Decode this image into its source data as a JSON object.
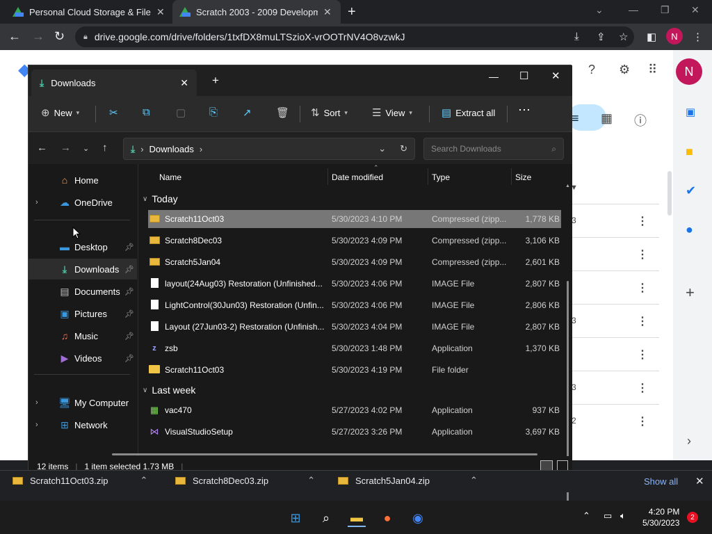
{
  "browser": {
    "tabs": [
      {
        "title": "Personal Cloud Storage & File Sh",
        "active": false
      },
      {
        "title": "Scratch 2003 - 2009 Developmen",
        "active": true
      }
    ],
    "url": "drive.google.com/drive/folders/1txfDX8muLTSzioX-vrOOTrNV4O8vzwkJ",
    "profile_initial": "N"
  },
  "drive": {
    "avatar_initial": "N",
    "row_partial_texts": [
      "3",
      "",
      "",
      "3",
      "3",
      "2"
    ]
  },
  "explorer": {
    "tab_title": "Downloads",
    "toolbar": {
      "new_label": "New",
      "sort_label": "Sort",
      "view_label": "View",
      "extract_label": "Extract all"
    },
    "breadcrumb": "Downloads",
    "search_placeholder": "Search Downloads",
    "sidebar": [
      {
        "label": "Home",
        "icon": "home-icon",
        "pinned": false,
        "expandable": false
      },
      {
        "label": "OneDrive",
        "icon": "onedrive-icon",
        "pinned": false,
        "expandable": true
      },
      {
        "label": "Desktop",
        "icon": "desktop-icon",
        "pinned": true,
        "expandable": false
      },
      {
        "label": "Downloads",
        "icon": "downloads-icon",
        "pinned": true,
        "expandable": false,
        "selected": true
      },
      {
        "label": "Documents",
        "icon": "documents-icon",
        "pinned": true,
        "expandable": false
      },
      {
        "label": "Pictures",
        "icon": "pictures-icon",
        "pinned": true,
        "expandable": false
      },
      {
        "label": "Music",
        "icon": "music-icon",
        "pinned": true,
        "expandable": false
      },
      {
        "label": "Videos",
        "icon": "videos-icon",
        "pinned": true,
        "expandable": false
      },
      {
        "label": "My Computer",
        "icon": "computer-icon",
        "pinned": false,
        "expandable": true
      },
      {
        "label": "Network",
        "icon": "network-icon",
        "pinned": false,
        "expandable": true
      }
    ],
    "columns": {
      "name": "Name",
      "date": "Date modified",
      "type": "Type",
      "size": "Size"
    },
    "groups": [
      {
        "label": "Today",
        "files": [
          {
            "name": "Scratch11Oct03",
            "date": "5/30/2023 4:10 PM",
            "type": "Compressed (zipp...",
            "size": "1,778 KB",
            "kind": "zip",
            "selected": true
          },
          {
            "name": "Scratch8Dec03",
            "date": "5/30/2023 4:09 PM",
            "type": "Compressed (zipp...",
            "size": "3,106 KB",
            "kind": "zip"
          },
          {
            "name": "Scratch5Jan04",
            "date": "5/30/2023 4:09 PM",
            "type": "Compressed (zipp...",
            "size": "2,601 KB",
            "kind": "zip"
          },
          {
            "name": "layout(24Aug03) Restoration (Unfinished...",
            "date": "5/30/2023 4:06 PM",
            "type": "IMAGE File",
            "size": "2,807 KB",
            "kind": "image"
          },
          {
            "name": "LightControl(30Jun03) Restoration (Unfin...",
            "date": "5/30/2023 4:06 PM",
            "type": "IMAGE File",
            "size": "2,806 KB",
            "kind": "image"
          },
          {
            "name": "Layout (27Jun03-2) Restoration (Unfinish...",
            "date": "5/30/2023 4:04 PM",
            "type": "IMAGE File",
            "size": "2,807 KB",
            "kind": "image"
          },
          {
            "name": "zsb",
            "date": "5/30/2023 1:48 PM",
            "type": "Application",
            "size": "1,370 KB",
            "kind": "app-z"
          },
          {
            "name": "Scratch11Oct03",
            "date": "5/30/2023 4:19 PM",
            "type": "File folder",
            "size": "",
            "kind": "folder"
          }
        ]
      },
      {
        "label": "Last week",
        "files": [
          {
            "name": "vac470",
            "date": "5/27/2023 4:02 PM",
            "type": "Application",
            "size": "937 KB",
            "kind": "app"
          },
          {
            "name": "VisualStudioSetup",
            "date": "5/27/2023 3:26 PM",
            "type": "Application",
            "size": "3,697 KB",
            "kind": "vs"
          }
        ]
      }
    ],
    "status": {
      "items": "12 items",
      "selected": "1 item selected  1.73 MB"
    }
  },
  "downloads_bar": {
    "items": [
      "Scratch11Oct03.zip",
      "Scratch8Dec03.zip",
      "Scratch5Jan04.zip"
    ],
    "show_all": "Show all"
  },
  "taskbar": {
    "time": "4:20 PM",
    "date": "5/30/2023",
    "notifications": "2"
  }
}
